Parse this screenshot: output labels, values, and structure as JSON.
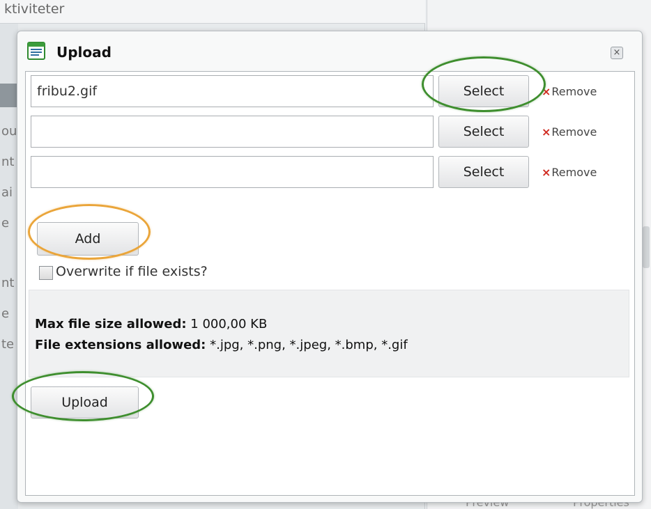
{
  "background": {
    "header_text": "ktiviteter",
    "left_fragments": [
      "ou",
      "nt",
      "ai",
      "e",
      "nt",
      "e",
      "te"
    ],
    "bottom_items": [
      "Preview",
      "Properties"
    ]
  },
  "dialog": {
    "title": "Upload",
    "close_symbol": "×",
    "file_rows": [
      {
        "value": "fribu2.gif",
        "select_label": "Select",
        "remove_label": "Remove"
      },
      {
        "value": "",
        "select_label": "Select",
        "remove_label": "Remove"
      },
      {
        "value": "",
        "select_label": "Select",
        "remove_label": "Remove"
      }
    ],
    "remove_x": "×",
    "add_label": "Add",
    "overwrite_label": "Overwrite if file exists?",
    "max_size_label": "Max file size allowed:",
    "max_size_value": "1 000,00 KB",
    "extensions_label": "File extensions allowed:",
    "extensions_value": "*.jpg, *.png, *.jpeg, *.bmp, *.gif",
    "upload_label": "Upload"
  },
  "annotations": {
    "green_color": "#3e8e2e",
    "orange_color": "#eaa53a"
  },
  "icons": {
    "title_icon": "document-list-icon",
    "close_icon": "close-icon",
    "remove_icon": "remove-x-icon"
  }
}
